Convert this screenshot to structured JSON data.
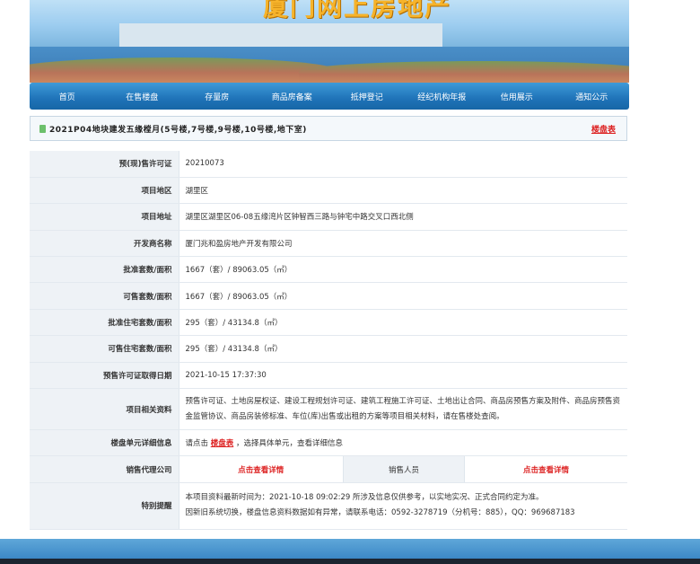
{
  "banner": {
    "title": "厦门网上房地产"
  },
  "nav": [
    "首页",
    "在售楼盘",
    "存量房",
    "商品房备案",
    "抵押登记",
    "经纪机构年报",
    "信用展示",
    "通知公示"
  ],
  "project": {
    "name": "2021P04地块建发五缘樘月(5号楼,7号楼,9号楼,10号楼,地下室)",
    "floor_link": "楼盘表"
  },
  "rows": [
    {
      "label": "预(现)售许可证",
      "value": "20210073"
    },
    {
      "label": "项目地区",
      "value": "湖里区"
    },
    {
      "label": "项目地址",
      "value": "湖里区湖里区06-08五缘湾片区钟智西三路与钟宅中路交叉口西北侧"
    },
    {
      "label": "开发商名称",
      "value": "厦门兆和盈房地产开发有限公司"
    },
    {
      "label": "批准套数/面积",
      "value": "1667（套）/ 89063.05（㎡）"
    },
    {
      "label": "可售套数/面积",
      "value": "1667（套）/ 89063.05（㎡）"
    },
    {
      "label": "批准住宅套数/面积",
      "value": "295（套）/ 43134.8（㎡）"
    },
    {
      "label": "可售住宅套数/面积",
      "value": "295（套）/ 43134.8（㎡）"
    },
    {
      "label": "预售许可证取得日期",
      "value": "2021-10-15 17:37:30"
    }
  ],
  "docs": {
    "label": "项目相关资料",
    "value": "预售许可证、土地房屋权证、建设工程规划许可证、建筑工程施工许可证、土地出让合同、商品房预售方案及附件、商品房预售资金监管协议、商品房装修标准、车位(库)出售或出租的方案等项目相关材料，请在售楼处查阅。"
  },
  "unit_detail": {
    "label": "楼盘单元详细信息",
    "prefix": "请点击",
    "link": "楼盘表",
    "suffix": "，选择具体单元，查看详细信息"
  },
  "agent": {
    "label": "销售代理公司",
    "link1": "点击查看详情",
    "label2": "销售人员",
    "link2": "点击查看详情"
  },
  "notice": {
    "label": "特别提醒",
    "line1": "本项目资料最新时间为：2021-10-18 09:02:29 所涉及信息仅供参考，以实地实况、正式合同约定为准。",
    "line2": "因新旧系统切换，楼盘信息资料数据如有异常，请联系电话：0592-3278719（分机号：885），QQ：969687183"
  }
}
